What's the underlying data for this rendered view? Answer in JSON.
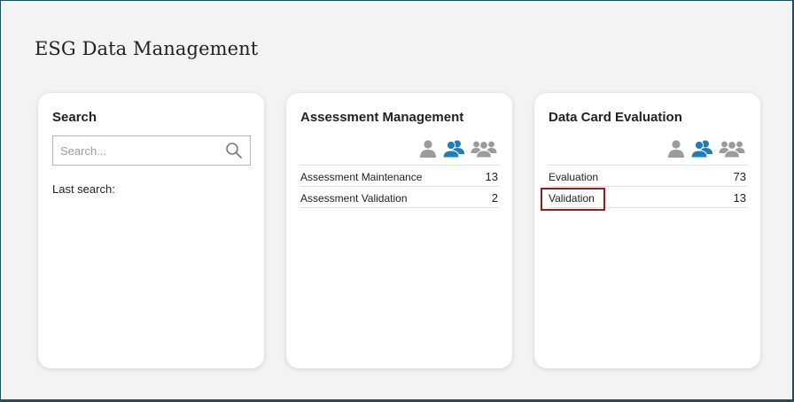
{
  "page": {
    "title": "ESG Data Management"
  },
  "search_card": {
    "title": "Search",
    "placeholder": "Search...",
    "value": "",
    "last_search_label": "Last search:"
  },
  "assessment_card": {
    "title": "Assessment Management",
    "view_icons": [
      "single-user-icon",
      "two-users-icon",
      "group-users-icon"
    ],
    "active_view": "two-users-icon",
    "rows": [
      {
        "label": "Assessment Maintenance",
        "count": "13"
      },
      {
        "label": "Assessment Validation",
        "count": "2"
      }
    ]
  },
  "datacard_card": {
    "title": "Data Card Evaluation",
    "view_icons": [
      "single-user-icon",
      "two-users-icon",
      "group-users-icon"
    ],
    "active_view": "two-users-icon",
    "rows": [
      {
        "label": "Evaluation",
        "count": "73"
      },
      {
        "label": "Validation",
        "count": "13"
      }
    ],
    "highlighted_row": "Validation"
  },
  "colors": {
    "background": "#f3f3f3",
    "card": "#ffffff",
    "icon_inactive": "#9b9b9b",
    "icon_active": "#1a7fbf",
    "highlight": "#9b1b1b"
  }
}
